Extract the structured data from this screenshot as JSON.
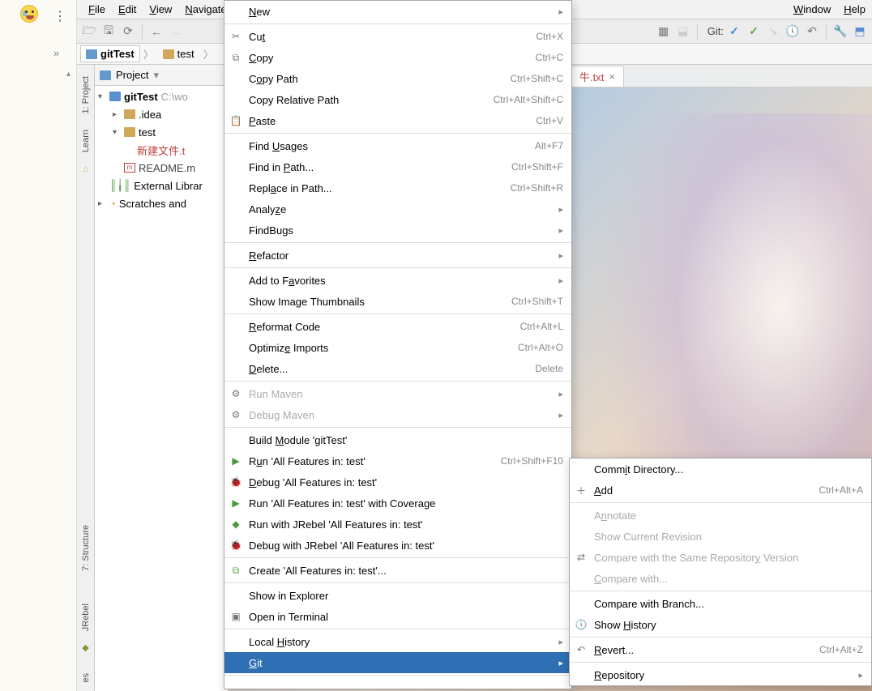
{
  "menubar": {
    "file": "File",
    "edit": "Edit",
    "view": "View",
    "navigate": "Navigate",
    "window": "Window",
    "help": "Help"
  },
  "toolbar": {
    "git_label": "Git:"
  },
  "breadcrumb": {
    "root": "gitTest",
    "folder": "test"
  },
  "panel": {
    "title": "Project"
  },
  "tree": {
    "root": "gitTest",
    "root_path": "C:\\wo",
    "idea": ".idea",
    "test": "test",
    "newfile": "新建文件.t",
    "readme": "README.m",
    "ext_libs": "External Librar",
    "scratches": "Scratches and"
  },
  "gutter": {
    "project": "1: Project",
    "learn": "Learn",
    "structure": "7: Structure",
    "jrebel": "JRebel",
    "favs": "es"
  },
  "tab": {
    "name": "牛.txt"
  },
  "ctx": {
    "new": "New",
    "cut": "Cut",
    "cut_k": "Ctrl+X",
    "copy": "Copy",
    "copy_k": "Ctrl+C",
    "copy_path": "Copy Path",
    "copy_path_k": "Ctrl+Shift+C",
    "copy_rel": "Copy Relative Path",
    "copy_rel_k": "Ctrl+Alt+Shift+C",
    "paste": "Paste",
    "paste_k": "Ctrl+V",
    "find_usages": "Find Usages",
    "find_usages_k": "Alt+F7",
    "find_in_path": "Find in Path...",
    "find_in_path_k": "Ctrl+Shift+F",
    "replace_in_path": "Replace in Path...",
    "replace_in_path_k": "Ctrl+Shift+R",
    "analyze": "Analyze",
    "findbugs": "FindBugs",
    "refactor": "Refactor",
    "add_fav": "Add to Favorites",
    "show_thumb": "Show Image Thumbnails",
    "show_thumb_k": "Ctrl+Shift+T",
    "reformat": "Reformat Code",
    "reformat_k": "Ctrl+Alt+L",
    "optimize": "Optimize Imports",
    "optimize_k": "Ctrl+Alt+O",
    "delete": "Delete...",
    "delete_k": "Delete",
    "run_maven": "Run Maven",
    "debug_maven": "Debug Maven",
    "build_module": "Build Module 'gitTest'",
    "run": "Run 'All Features in: test'",
    "run_k": "Ctrl+Shift+F10",
    "debug": "Debug 'All Features in: test'",
    "coverage": "Run 'All Features in: test' with Coverage",
    "jrebel_run": "Run with JRebel 'All Features in: test'",
    "jrebel_debug": "Debug with JRebel 'All Features in: test'",
    "create": "Create 'All Features in: test'...",
    "show_explorer": "Show in Explorer",
    "open_terminal": "Open in Terminal",
    "local_history": "Local History",
    "git": "Git"
  },
  "submenu": {
    "commit": "Commit Directory...",
    "add": "Add",
    "add_k": "Ctrl+Alt+A",
    "annotate": "Annotate",
    "show_cur": "Show Current Revision",
    "compare_same": "Compare with the Same Repository Version",
    "compare_with": "Compare with...",
    "compare_branch": "Compare with Branch...",
    "show_history": "Show History",
    "revert": "Revert...",
    "revert_k": "Ctrl+Alt+Z",
    "repository": "Repository"
  }
}
